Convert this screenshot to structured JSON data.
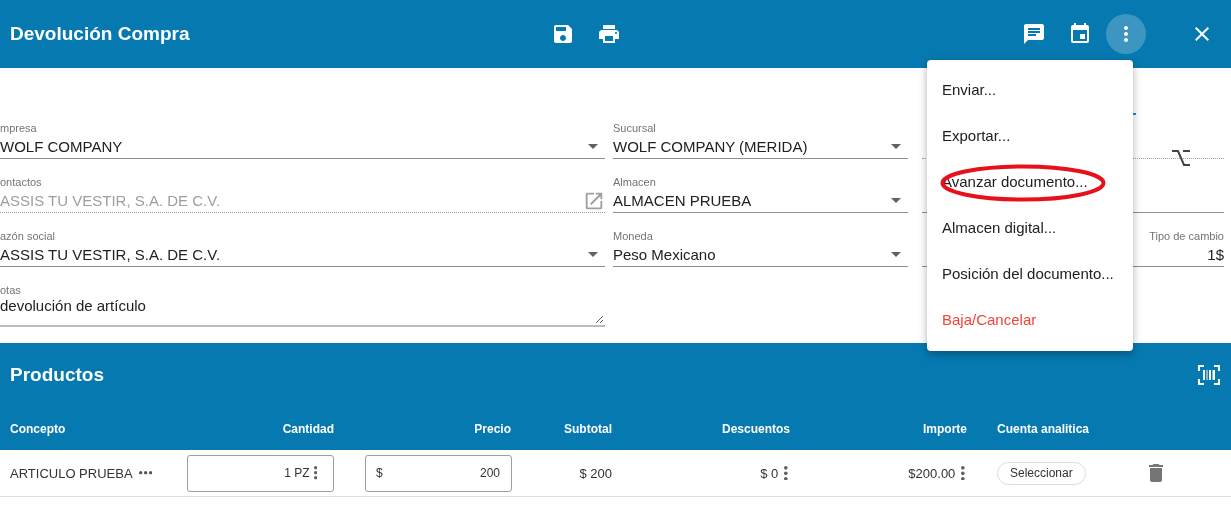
{
  "header": {
    "title": "Devolución Compra"
  },
  "menu": {
    "open": true,
    "items": [
      {
        "label": "Enviar...",
        "kind": "normal",
        "circled": false
      },
      {
        "label": "Exportar...",
        "kind": "normal",
        "circled": false
      },
      {
        "label": "Avanzar documento...",
        "kind": "normal",
        "circled": true
      },
      {
        "label": "Almacen digital...",
        "kind": "normal",
        "circled": false
      },
      {
        "label": "Posición del documento...",
        "kind": "normal",
        "circled": false
      },
      {
        "label": "Baja/Cancelar",
        "kind": "danger",
        "circled": false
      }
    ]
  },
  "form": {
    "rows": [
      [
        {
          "label": "mpresa",
          "value": "WOLF COMPANY",
          "kind": "select",
          "disabled": false
        },
        {
          "label": "Sucursal",
          "value": "WOLF COMPANY (MERIDA)",
          "kind": "select",
          "disabled": false
        },
        {
          "kind": "text",
          "disabled": true
        }
      ],
      [
        {
          "label": "ontactos",
          "value": "ASSIS TU VESTIR, S.A. DE C.V.",
          "kind": "link",
          "disabled": true
        },
        {
          "label": "Almacen",
          "value": "ALMACEN PRUEBA",
          "kind": "select",
          "disabled": false
        },
        {
          "kind": "text",
          "disabled": false
        }
      ],
      [
        {
          "label": "azón social",
          "value": "ASSIS TU VESTIR, S.A. DE C.V.",
          "kind": "select",
          "disabled": false
        },
        {
          "label": "Moneda",
          "value": "Peso Mexicano",
          "kind": "select",
          "disabled": false
        },
        {
          "label": "Tipo de cambio",
          "value": "1$",
          "kind": "number",
          "disabled": false
        }
      ],
      [
        {
          "label": "otas",
          "value": "devolución de artículo",
          "kind": "textarea",
          "disabled": false
        }
      ]
    ]
  },
  "products": {
    "title": "Productos",
    "columns": [
      "Concepto",
      "Cantidad",
      "Precio",
      "Subtotal",
      "Descuentos",
      "Importe",
      "Cuenta analitica"
    ],
    "rows": [
      {
        "concepto": "ARTICULO PRUEBA",
        "cantidad": "1 PZ",
        "precio_symbol": "$",
        "precio": "200",
        "subtotal": "$ 200",
        "descuentos": "$ 0",
        "importe": "$200.00",
        "cuenta_button": "Seleccionar"
      }
    ]
  }
}
